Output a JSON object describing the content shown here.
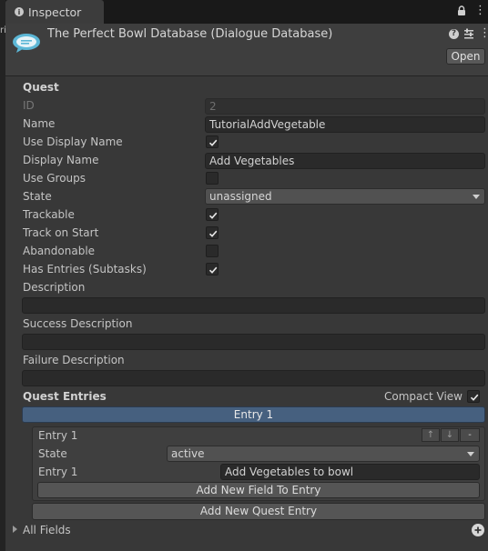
{
  "window": {
    "tab_label": "Inspector",
    "left_strip_glyph": "ri"
  },
  "header": {
    "title": "The Perfect Bowl Database (Dialogue Database)",
    "open_label": "Open",
    "icons": [
      "database-icon",
      "help-icon",
      "preset-icon",
      "kebab-menu-icon"
    ]
  },
  "quest": {
    "section_label": "Quest",
    "id_label": "ID",
    "id_value": "2",
    "name_label": "Name",
    "name_value": "TutorialAddVegetable",
    "use_display_name_label": "Use Display Name",
    "use_display_name": true,
    "display_name_label": "Display Name",
    "display_name_value": "Add Vegetables",
    "use_groups_label": "Use Groups",
    "use_groups": false,
    "state_label": "State",
    "state_value": "unassigned",
    "trackable_label": "Trackable",
    "trackable": true,
    "track_on_start_label": "Track on Start",
    "track_on_start": true,
    "abandonable_label": "Abandonable",
    "abandonable": false,
    "has_entries_label": "Has Entries (Subtasks)",
    "has_entries": true,
    "description_label": "Description",
    "description_value": "",
    "success_description_label": "Success Description",
    "success_description_value": "",
    "failure_description_label": "Failure Description",
    "failure_description_value": ""
  },
  "entries": {
    "section_label": "Quest Entries",
    "compact_view_label": "Compact View",
    "compact_view": true,
    "header_label": "Entry 1",
    "entry_title": "Entry 1",
    "entry_state_label": "State",
    "entry_state_value": "active",
    "entry_text_label": "Entry 1",
    "entry_text_value": "Add Vegetables to bowl",
    "move_up": "↑",
    "move_down": "↓",
    "remove": "-",
    "add_field_label": "Add New Field To Entry",
    "add_entry_label": "Add New Quest Entry"
  },
  "footer": {
    "all_fields_label": "All Fields"
  },
  "colors": {
    "background": "#383838",
    "entry_header": "#46607f",
    "field": "#2a2a2a"
  }
}
